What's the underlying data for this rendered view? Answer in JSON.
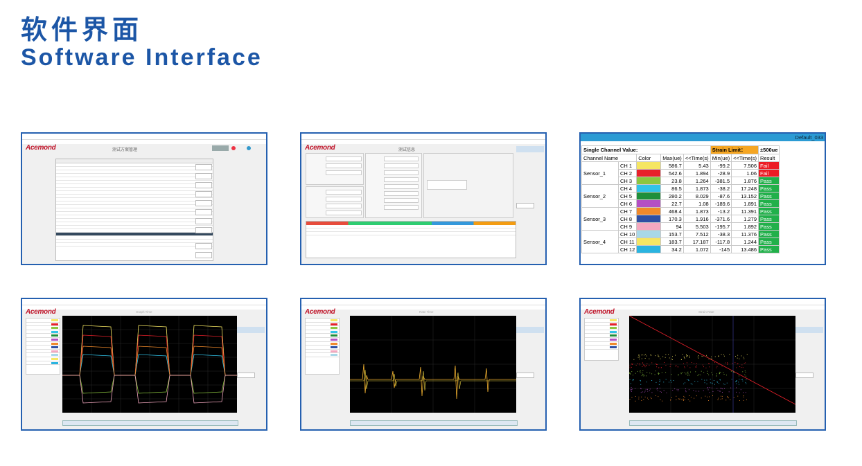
{
  "heading": {
    "cn": "软件界面",
    "en": "Software Interface"
  },
  "colors": {
    "heading": "#1c56a6",
    "border": "#2560b0",
    "pass": "#21b04a",
    "fail": "#ec1c24",
    "strain_limit": "#f5a623",
    "header_bar": "#2b9bd4"
  },
  "shot1": {
    "logo": "Acemond",
    "title": "测试方案管理"
  },
  "shot2": {
    "logo": "Acemond",
    "title": "测试信息"
  },
  "shot3": {
    "default_label": "Default_033",
    "single_channel_label": "Single Channel Value:",
    "strain_limit_label": "Strain Limit：",
    "limit_value": "±500ue",
    "headers": [
      "Channel Name",
      "",
      "Color",
      "Max(ue)",
      "<<Time(s)",
      "Min(ue)",
      "<<Time(s)",
      "Result"
    ],
    "rows": [
      {
        "group": "Sensor_1",
        "ch": "CH 1",
        "color": "#f5e663",
        "max": "586.7",
        "tmax": "5.43",
        "min": "-99.2",
        "tmin": "7.506",
        "result": "Fail"
      },
      {
        "group": "",
        "ch": "CH 2",
        "color": "#e8202a",
        "max": "542.6",
        "tmax": "1.894",
        "min": "-28.9",
        "tmin": "1.06",
        "result": "Fail"
      },
      {
        "group": "",
        "ch": "CH 3",
        "color": "#8cc63f",
        "max": "23.8",
        "tmax": "1.264",
        "min": "-381.5",
        "tmin": "1.876",
        "result": "Pass"
      },
      {
        "group": "Sensor_2",
        "ch": "CH 4",
        "color": "#31c3e8",
        "max": "86.5",
        "tmax": "1.873",
        "min": "-38.2",
        "tmin": "17.248",
        "result": "Pass"
      },
      {
        "group": "",
        "ch": "CH 5",
        "color": "#1f8f3b",
        "max": "280.2",
        "tmax": "8.029",
        "min": "-87.6",
        "tmin": "13.152",
        "result": "Pass"
      },
      {
        "group": "",
        "ch": "CH 6",
        "color": "#b44fc4",
        "max": "22.7",
        "tmax": "1.08",
        "min": "-189.6",
        "tmin": "1.891",
        "result": "Pass"
      },
      {
        "group": "Sensor_3",
        "ch": "CH 7",
        "color": "#f0892a",
        "max": "468.4",
        "tmax": "1.873",
        "min": "-13.2",
        "tmin": "11.391",
        "result": "Pass"
      },
      {
        "group": "",
        "ch": "CH 8",
        "color": "#2e4fa3",
        "max": "170.3",
        "tmax": "1.916",
        "min": "-371.6",
        "tmin": "1.279",
        "result": "Pass"
      },
      {
        "group": "",
        "ch": "CH 9",
        "color": "#f4a8c0",
        "max": "94",
        "tmax": "5.503",
        "min": "-195.7",
        "tmin": "1.892",
        "result": "Pass"
      },
      {
        "group": "Sensor_4",
        "ch": "CH 10",
        "color": "#a8d8e8",
        "max": "153.7",
        "tmax": "7.512",
        "min": "-38.3",
        "tmin": "11.376",
        "result": "Pass"
      },
      {
        "group": "",
        "ch": "CH 11",
        "color": "#f5e663",
        "max": "183.7",
        "tmax": "17.187",
        "min": "-117.8",
        "tmin": "1.244",
        "result": "Pass"
      },
      {
        "group": "",
        "ch": "CH 12",
        "color": "#2ab4e0",
        "max": "34.2",
        "tmax": "1.072",
        "min": "-145",
        "tmin": "13.486",
        "result": "Pass"
      }
    ]
  },
  "shot4": {
    "logo": "Acemond",
    "title": "Graph Time"
  },
  "shot5": {
    "logo": "Acemond",
    "title": "Rate Time"
  },
  "shot6": {
    "logo": "Acemond",
    "title": "Strain Rate"
  }
}
